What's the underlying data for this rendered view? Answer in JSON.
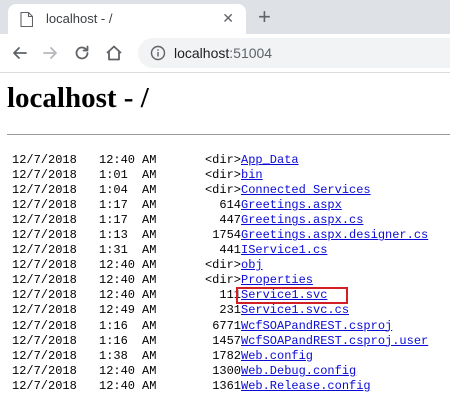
{
  "browser": {
    "tab_title": "localhost - /",
    "url_host": "localhost",
    "url_port": ":51004"
  },
  "page": {
    "heading": "localhost - /"
  },
  "entries": [
    {
      "date": "12/7/2018",
      "time": "12:40",
      "ampm": "AM",
      "size": "<dir>",
      "name": "App_Data"
    },
    {
      "date": "12/7/2018",
      "time": "1:01",
      "ampm": "AM",
      "size": "<dir>",
      "name": "bin"
    },
    {
      "date": "12/7/2018",
      "time": "1:04",
      "ampm": "AM",
      "size": "<dir>",
      "name": "Connected Services"
    },
    {
      "date": "12/7/2018",
      "time": "1:17",
      "ampm": "AM",
      "size": "614",
      "name": "Greetings.aspx"
    },
    {
      "date": "12/7/2018",
      "time": "1:17",
      "ampm": "AM",
      "size": "447",
      "name": "Greetings.aspx.cs"
    },
    {
      "date": "12/7/2018",
      "time": "1:13",
      "ampm": "AM",
      "size": "1754",
      "name": "Greetings.aspx.designer.cs"
    },
    {
      "date": "12/7/2018",
      "time": "1:31",
      "ampm": "AM",
      "size": "441",
      "name": "IService1.cs"
    },
    {
      "date": "12/7/2018",
      "time": "12:40",
      "ampm": "AM",
      "size": "<dir>",
      "name": "obj"
    },
    {
      "date": "12/7/2018",
      "time": "12:40",
      "ampm": "AM",
      "size": "<dir>",
      "name": "Properties"
    },
    {
      "date": "12/7/2018",
      "time": "12:40",
      "ampm": "AM",
      "size": "111",
      "name": "Service1.svc"
    },
    {
      "date": "12/7/2018",
      "time": "12:49",
      "ampm": "AM",
      "size": "231",
      "name": "Service1.svc.cs"
    },
    {
      "date": "12/7/2018",
      "time": "1:16",
      "ampm": "AM",
      "size": "6771",
      "name": "WcfSOAPandREST.csproj"
    },
    {
      "date": "12/7/2018",
      "time": "1:16",
      "ampm": "AM",
      "size": "1457",
      "name": "WcfSOAPandREST.csproj.user"
    },
    {
      "date": "12/7/2018",
      "time": "1:38",
      "ampm": "AM",
      "size": "1782",
      "name": "Web.config"
    },
    {
      "date": "12/7/2018",
      "time": "12:40",
      "ampm": "AM",
      "size": "1300",
      "name": "Web.Debug.config"
    },
    {
      "date": "12/7/2018",
      "time": "12:40",
      "ampm": "AM",
      "size": "1361",
      "name": "Web.Release.config"
    }
  ],
  "highlight_color": "#d21f26",
  "link_color": "#0b0bd6"
}
